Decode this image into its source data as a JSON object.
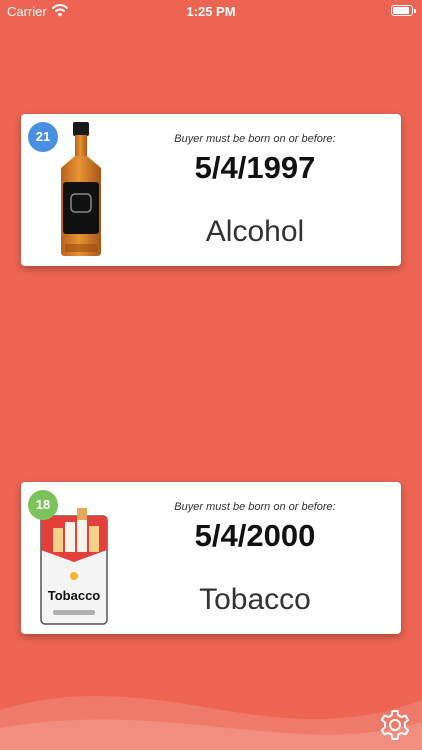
{
  "status_bar": {
    "carrier": "Carrier",
    "time": "1:25 PM",
    "battery_level": 0.95,
    "icons": [
      "wifi-icon",
      "battery-icon"
    ]
  },
  "colors": {
    "background": "#EE6452",
    "alcohol_badge": "#4A90E2",
    "tobacco_badge": "#7DC25A"
  },
  "cards": [
    {
      "age": "21",
      "caption": "Buyer must be born on or before:",
      "date": "5/4/1997",
      "product": "Alcohol",
      "icon": "whiskey-bottle-icon"
    },
    {
      "age": "18",
      "caption": "Buyer must be born on or before:",
      "date": "5/4/2000",
      "product": "Tobacco",
      "pack_label": "Tobacco",
      "icon": "cigarette-pack-icon"
    }
  ],
  "footer": {
    "icon": "gear-icon"
  }
}
